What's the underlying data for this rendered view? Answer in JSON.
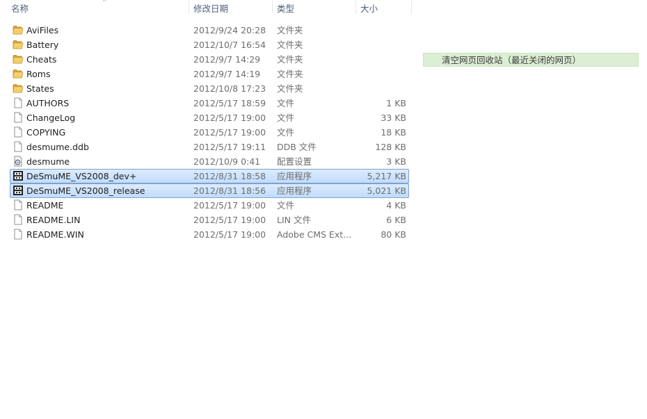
{
  "columns": {
    "name": "名称",
    "date": "修改日期",
    "type": "类型",
    "size": "大小"
  },
  "files": [
    {
      "name": "AviFiles",
      "date": "2012/9/24 20:28",
      "type": "文件夹",
      "size": "",
      "icon": "folder-icon",
      "selected": false
    },
    {
      "name": "Battery",
      "date": "2012/10/7 16:54",
      "type": "文件夹",
      "size": "",
      "icon": "folder-icon",
      "selected": false
    },
    {
      "name": "Cheats",
      "date": "2012/9/7 14:29",
      "type": "文件夹",
      "size": "",
      "icon": "folder-icon",
      "selected": false
    },
    {
      "name": "Roms",
      "date": "2012/9/7 14:19",
      "type": "文件夹",
      "size": "",
      "icon": "folder-icon",
      "selected": false
    },
    {
      "name": "States",
      "date": "2012/10/8 17:23",
      "type": "文件夹",
      "size": "",
      "icon": "folder-icon",
      "selected": false
    },
    {
      "name": "AUTHORS",
      "date": "2012/5/17 18:59",
      "type": "文件",
      "size": "1 KB",
      "icon": "file-icon",
      "selected": false
    },
    {
      "name": "ChangeLog",
      "date": "2012/5/17 19:00",
      "type": "文件",
      "size": "33 KB",
      "icon": "file-icon",
      "selected": false
    },
    {
      "name": "COPYING",
      "date": "2012/5/17 19:00",
      "type": "文件",
      "size": "18 KB",
      "icon": "file-icon",
      "selected": false
    },
    {
      "name": "desmume.ddb",
      "date": "2012/5/17 19:11",
      "type": "DDB 文件",
      "size": "128 KB",
      "icon": "file-icon",
      "selected": false
    },
    {
      "name": "desmume",
      "date": "2012/10/9 0:41",
      "type": "配置设置",
      "size": "3 KB",
      "icon": "settings-file-icon",
      "selected": false
    },
    {
      "name": "DeSmuME_VS2008_dev+",
      "date": "2012/8/31 18:58",
      "type": "应用程序",
      "size": "5,217 KB",
      "icon": "application-icon",
      "selected": true
    },
    {
      "name": "DeSmuME_VS2008_release",
      "date": "2012/8/31 18:56",
      "type": "应用程序",
      "size": "5,021 KB",
      "icon": "application-icon",
      "selected": true
    },
    {
      "name": "README",
      "date": "2012/5/17 19:00",
      "type": "文件",
      "size": "4 KB",
      "icon": "file-icon",
      "selected": false
    },
    {
      "name": "README.LIN",
      "date": "2012/5/17 19:00",
      "type": "LIN 文件",
      "size": "6 KB",
      "icon": "file-icon",
      "selected": false
    },
    {
      "name": "README.WIN",
      "date": "2012/5/17 19:00",
      "type": "Adobe CMS Ext...",
      "size": "80 KB",
      "icon": "file-icon",
      "selected": false
    }
  ],
  "banner": {
    "text": "清空网页回收站（最近关闭的网页）"
  },
  "colors": {
    "selection": "#c9e0fc",
    "banner": "#dcefd4"
  }
}
